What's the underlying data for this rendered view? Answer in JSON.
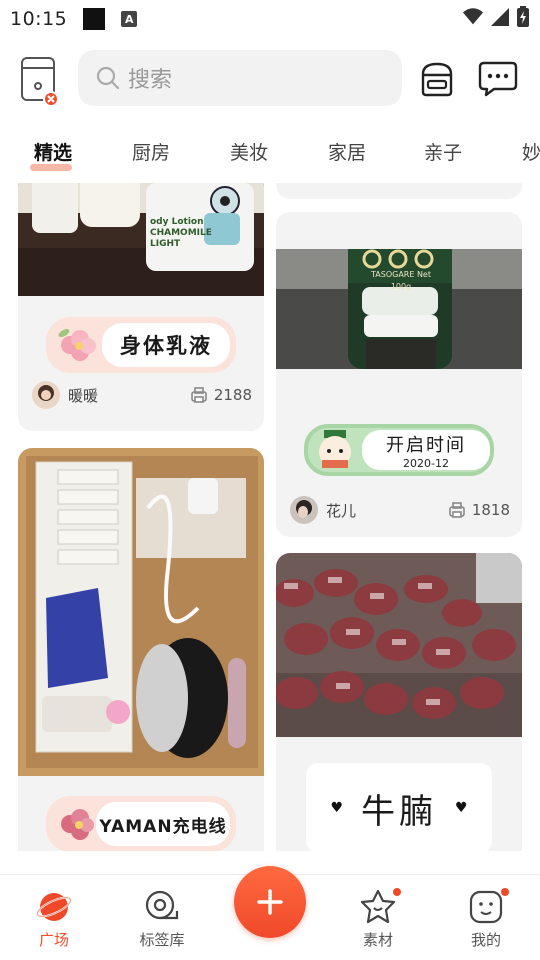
{
  "status_bar": {
    "time": "10:15",
    "notification_label": "A"
  },
  "header": {
    "search_placeholder": "搜索"
  },
  "tabs": [
    {
      "label": "精选",
      "active": true
    },
    {
      "label": "厨房",
      "active": false
    },
    {
      "label": "美妆",
      "active": false
    },
    {
      "label": "家居",
      "active": false
    },
    {
      "label": "亲子",
      "active": false
    },
    {
      "label": "妙",
      "active": false
    }
  ],
  "feed": {
    "left": [
      {
        "label_text": "身体乳液",
        "author": "暖暖",
        "count": "2188",
        "photo_text": "ody Lotion CHAMOMILE LIGHT"
      },
      {
        "label_text": "YAMAN充电线"
      }
    ],
    "right": [
      {
        "label_text": "开启时间",
        "label_date": "2020-12",
        "author": "花儿",
        "count": "1818",
        "photo_text": "TASOGARE Net 100g"
      },
      {
        "label_text": "牛腩"
      }
    ]
  },
  "bottom_nav": [
    {
      "label": "广场",
      "icon": "planet-icon",
      "active": true
    },
    {
      "label": "标签库",
      "icon": "tape-roll-icon",
      "active": false
    },
    {
      "label": "素材",
      "icon": "star-face-icon",
      "active": false,
      "badge": true
    },
    {
      "label": "我的",
      "icon": "smile-face-icon",
      "active": false,
      "badge": true
    }
  ],
  "colors": {
    "accent": "#f04e2b",
    "card_bg": "#f3f3f3",
    "tab_underline": "#f4a08a"
  }
}
